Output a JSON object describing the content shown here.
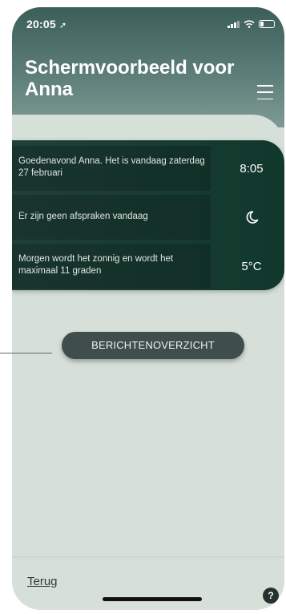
{
  "status_bar": {
    "time": "20:05",
    "location_glyph": "➚",
    "icons": [
      "signal-icon",
      "wifi-icon",
      "battery-icon"
    ]
  },
  "header": {
    "title": "Schermvoorbeeld voor Anna",
    "menu_icon": "hamburger-menu-icon"
  },
  "panel": {
    "rows": [
      {
        "text": "Goedenavond Anna. Het is vandaag zaterdag 27 februari",
        "value": "8:05"
      },
      {
        "text": "Er zijn geen afspraken vandaag",
        "value": "",
        "icon": "moon-icon"
      },
      {
        "text": "Morgen wordt het zonnig en wordt het maximaal 11 graden",
        "value": "5°C"
      }
    ]
  },
  "messages_button": {
    "label": "BERICHTENOVERZICHT"
  },
  "footer": {
    "back_label": "Terug",
    "help_label": "?"
  },
  "colors": {
    "header_top": "#3c5e59",
    "panel": "#11382c",
    "background": "#d6e0d9",
    "button": "#3f4d4b"
  }
}
